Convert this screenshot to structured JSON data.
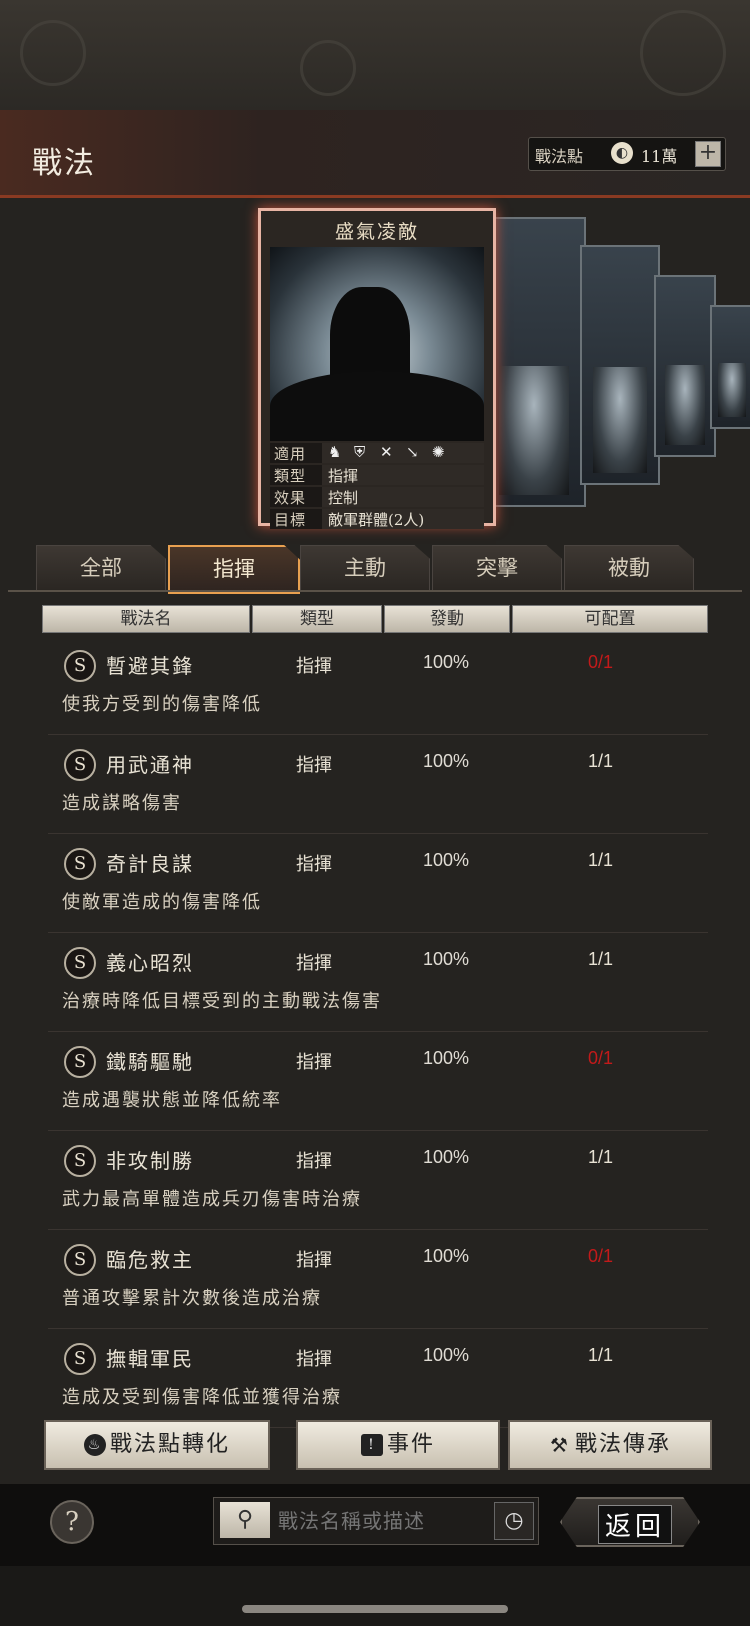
{
  "header": {
    "title": "戰法",
    "points_label": "戰法點",
    "points_value": "11萬",
    "add_label": "+"
  },
  "card": {
    "name": "盛氣凌敵",
    "info": [
      {
        "key": "適用",
        "value": ""
      },
      {
        "key": "類型",
        "value": "指揮"
      },
      {
        "key": "效果",
        "value": "控制"
      },
      {
        "key": "目標",
        "value": "敵軍群體(2人)"
      }
    ],
    "suit_icons": [
      "cavalry-icon",
      "shield-icon",
      "crossbow-icon",
      "spear-icon",
      "wheel-icon"
    ]
  },
  "tabs": [
    {
      "label": "全部"
    },
    {
      "label": "指揮"
    },
    {
      "label": "主動"
    },
    {
      "label": "突擊"
    },
    {
      "label": "被動"
    }
  ],
  "active_tab": "指揮",
  "table": {
    "headers": [
      "戰法名",
      "類型",
      "發動",
      "可配置"
    ],
    "rows": [
      {
        "grade": "S",
        "name": "暫避其鋒",
        "type": "指揮",
        "rate": "100%",
        "config": "0/1",
        "desc": "使我方受到的傷害降低"
      },
      {
        "grade": "S",
        "name": "用武通神",
        "type": "指揮",
        "rate": "100%",
        "config": "1/1",
        "desc": "造成謀略傷害"
      },
      {
        "grade": "S",
        "name": "奇計良謀",
        "type": "指揮",
        "rate": "100%",
        "config": "1/1",
        "desc": "使敵軍造成的傷害降低"
      },
      {
        "grade": "S",
        "name": "義心昭烈",
        "type": "指揮",
        "rate": "100%",
        "config": "1/1",
        "desc": "治療時降低目標受到的主動戰法傷害"
      },
      {
        "grade": "S",
        "name": "鐵騎驅馳",
        "type": "指揮",
        "rate": "100%",
        "config": "0/1",
        "desc": "造成遇襲狀態並降低統率"
      },
      {
        "grade": "S",
        "name": "非攻制勝",
        "type": "指揮",
        "rate": "100%",
        "config": "1/1",
        "desc": "武力最高單體造成兵刃傷害時治療"
      },
      {
        "grade": "S",
        "name": "臨危救主",
        "type": "指揮",
        "rate": "100%",
        "config": "0/1",
        "desc": "普通攻擊累計次數後造成治療"
      },
      {
        "grade": "S",
        "name": "撫輯軍民",
        "type": "指揮",
        "rate": "100%",
        "config": "1/1",
        "desc": "造成及受到傷害降低並獲得治療"
      }
    ]
  },
  "buttons": {
    "convert": "戰法點轉化",
    "events": "事件",
    "inherit": "戰法傳承"
  },
  "search": {
    "placeholder": "戰法名稱或描述"
  },
  "back_label": "返回",
  "help_label": "?",
  "colors": {
    "accent_red": "#c21a1a",
    "tab_active_border": "#e8a050",
    "card_border": "#e8b4a4"
  }
}
